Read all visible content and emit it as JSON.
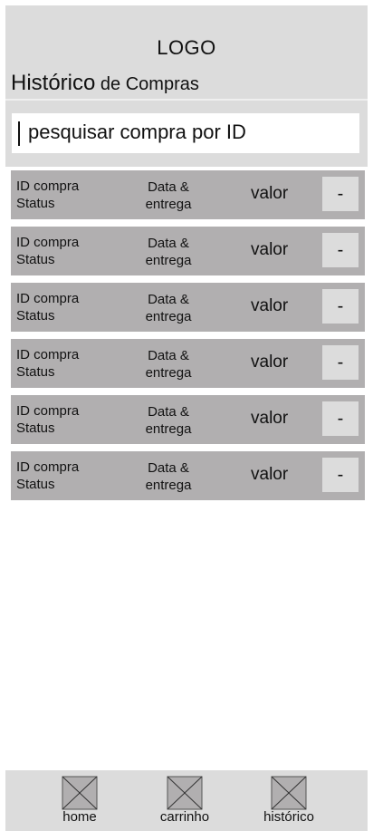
{
  "header": {
    "logo": "LOGO",
    "title_main": "Histórico",
    "title_rest": " de Compras"
  },
  "search": {
    "placeholder": "pesquisar compra por ID"
  },
  "purchases": [
    {
      "id_label": "ID compra",
      "status_label": "Status",
      "date_label_1": "Data &",
      "date_label_2": "entrega",
      "value_label": "valor",
      "action_label": "-"
    },
    {
      "id_label": "ID compra",
      "status_label": "Status",
      "date_label_1": "Data &",
      "date_label_2": "entrega",
      "value_label": "valor",
      "action_label": "-"
    },
    {
      "id_label": "ID compra",
      "status_label": "Status",
      "date_label_1": "Data &",
      "date_label_2": "entrega",
      "value_label": "valor",
      "action_label": "-"
    },
    {
      "id_label": "ID compra",
      "status_label": "Status",
      "date_label_1": "Data &",
      "date_label_2": "entrega",
      "value_label": "valor",
      "action_label": "-"
    },
    {
      "id_label": "ID compra",
      "status_label": "Status",
      "date_label_1": "Data &",
      "date_label_2": "entrega",
      "value_label": "valor",
      "action_label": "-"
    },
    {
      "id_label": "ID compra",
      "status_label": "Status",
      "date_label_1": "Data &",
      "date_label_2": "entrega",
      "value_label": "valor",
      "action_label": "-"
    }
  ],
  "nav": [
    {
      "label": "home",
      "icon": "image-placeholder-icon"
    },
    {
      "label": "carrinho",
      "icon": "image-placeholder-icon"
    },
    {
      "label": "histórico",
      "icon": "image-placeholder-icon"
    }
  ],
  "colors": {
    "panel": "#dcdcdc",
    "row": "#b1afb0",
    "button": "#dcdcdc"
  }
}
